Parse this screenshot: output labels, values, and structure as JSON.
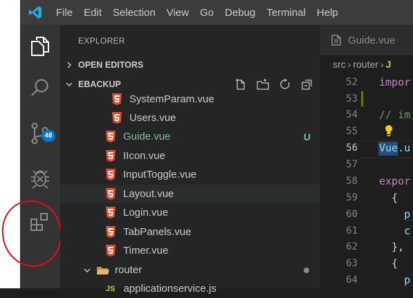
{
  "menu": [
    "File",
    "Edit",
    "Selection",
    "View",
    "Go",
    "Debug",
    "Terminal",
    "Help"
  ],
  "activity": {
    "scm_badge": "48"
  },
  "explorer": {
    "title": "EXPLORER",
    "open_editors": "OPEN EDITORS",
    "folder": "EBACKUP",
    "files": [
      {
        "name": "SystemParam.vue"
      },
      {
        "name": "Users.vue"
      },
      {
        "name": "Guide.vue",
        "status": "U"
      },
      {
        "name": "IIcon.vue"
      },
      {
        "name": "InputToggle.vue"
      },
      {
        "name": "Layout.vue"
      },
      {
        "name": "Login.vue"
      },
      {
        "name": "TabPanels.vue"
      },
      {
        "name": "Timer.vue"
      }
    ],
    "router_folder": "router",
    "next_file": "applicationservice.js"
  },
  "editor": {
    "tab": "Guide.vue",
    "breadcrumb": [
      "src",
      "router",
      "J"
    ],
    "line_numbers": [
      "52",
      "53",
      "54",
      "55",
      "56",
      "57",
      "58",
      "59",
      "60",
      "61",
      "62",
      "63",
      "64"
    ],
    "code_lines": [
      "impor",
      "",
      "// im",
      "",
      "Vue.u",
      "",
      "expor",
      "  {",
      "    p",
      "    c",
      "  },",
      "  {",
      "    p"
    ]
  },
  "colors": {
    "activity_bar": "#333333",
    "side_bar": "#252526",
    "editor": "#1e1e1e",
    "accent": "#007acc",
    "untracked": "#73c991",
    "html5": "#e44d26",
    "annotation": "#e0101a"
  }
}
